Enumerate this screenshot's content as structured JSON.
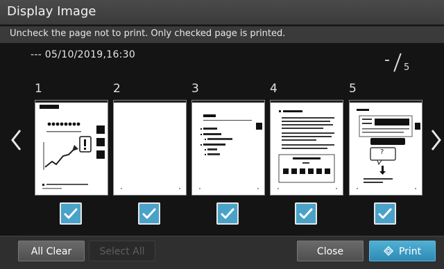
{
  "window": {
    "title": "Display Image"
  },
  "instruction": "Uncheck the page not to print. Only checked page is printed.",
  "job_info": "--- 05/10/2019,16:30",
  "page_indicator": {
    "current": "-",
    "total": "5"
  },
  "pages": [
    {
      "number": "1",
      "checked": true
    },
    {
      "number": "2",
      "checked": true
    },
    {
      "number": "3",
      "checked": true
    },
    {
      "number": "4",
      "checked": true
    },
    {
      "number": "5",
      "checked": true
    }
  ],
  "thumb5": {
    "question_mark": "?"
  },
  "buttons": {
    "all_clear": "All Clear",
    "select_all": "Select All",
    "close": "Close",
    "print": "Print"
  },
  "colors": {
    "checkbox": "#4aa2c9",
    "print_button": "#3a9cc6"
  },
  "icons": {
    "nav_left": "chevron-left-icon",
    "nav_right": "chevron-right-icon",
    "checkmark": "checkmark-icon",
    "print": "diamond-print-icon"
  }
}
